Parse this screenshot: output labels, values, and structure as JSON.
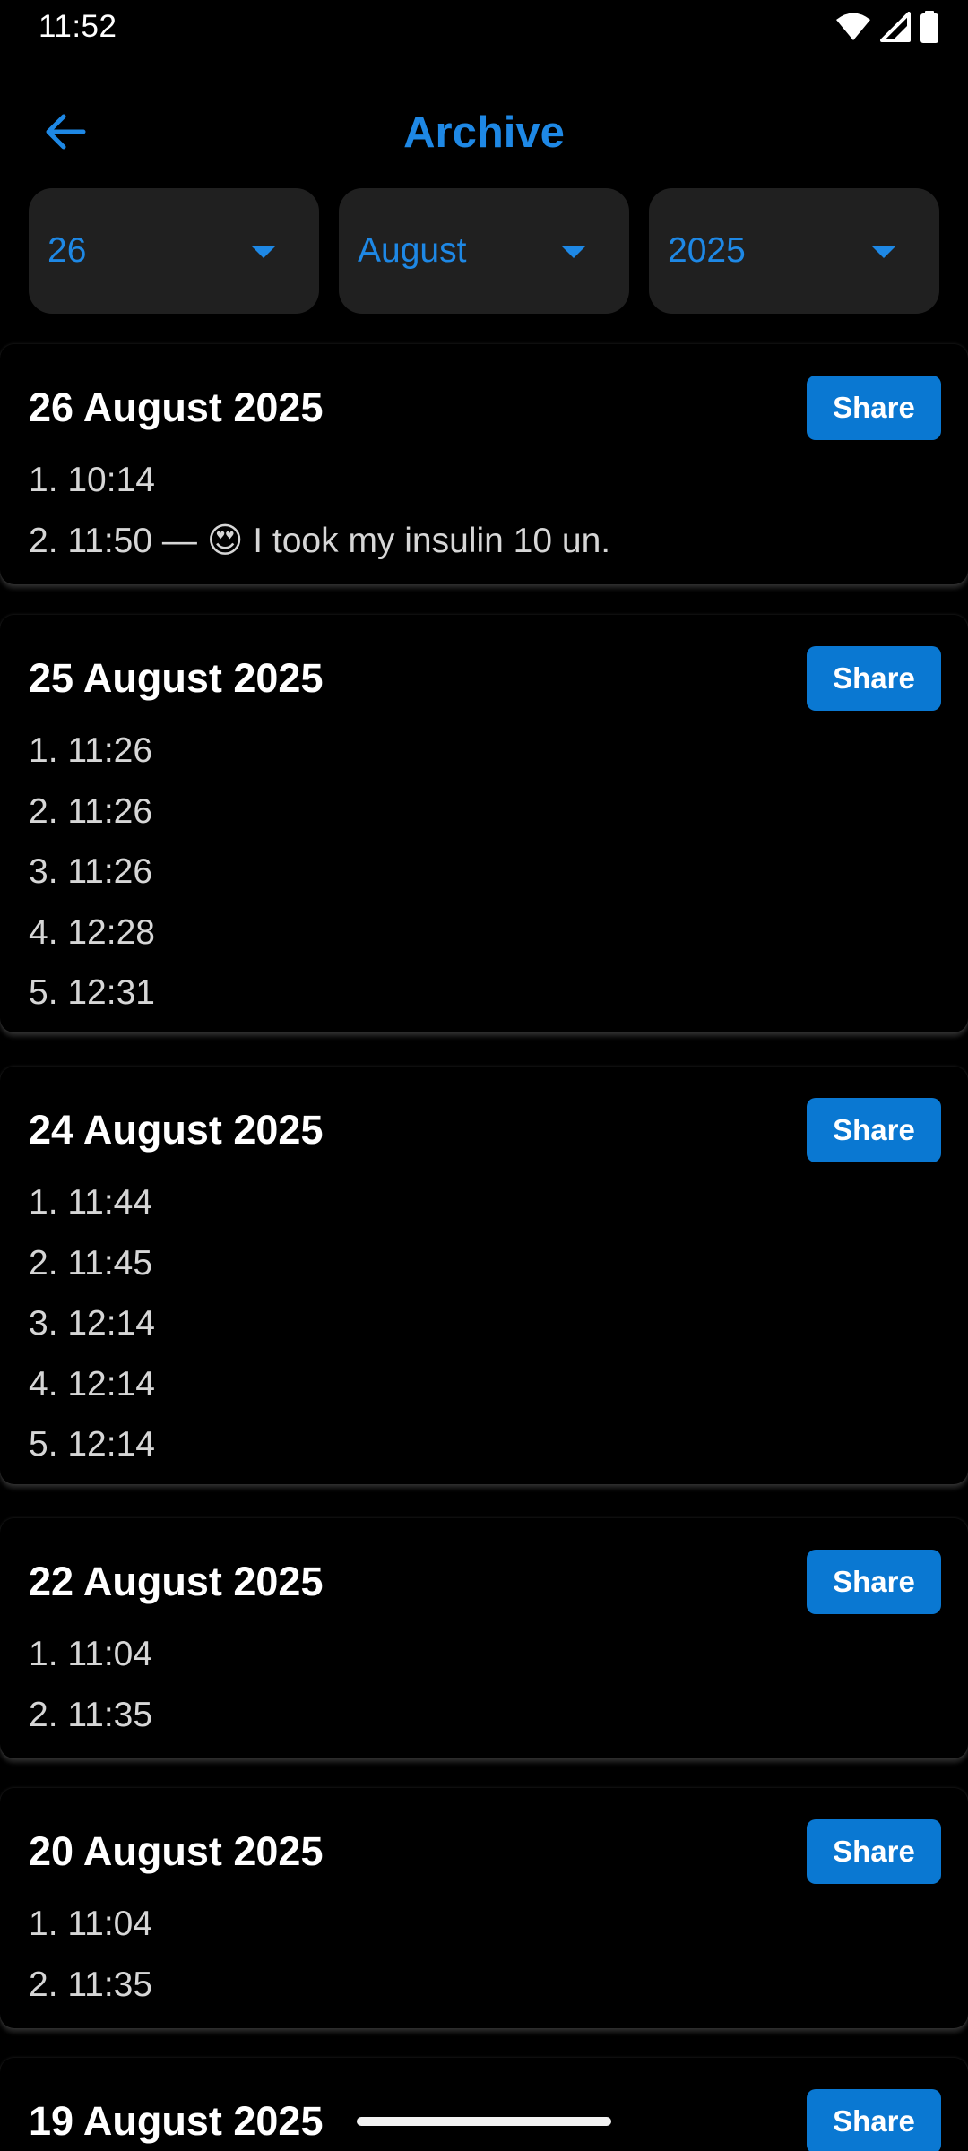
{
  "status_bar": {
    "time": "11:52",
    "icons": [
      "wifi-icon",
      "cell-signal-icon",
      "battery-icon"
    ]
  },
  "app_bar": {
    "back_icon": "arrow-left-icon",
    "title": "Archive"
  },
  "filters": {
    "day": "26",
    "month": "August",
    "year": "2025"
  },
  "share_label": "Share",
  "days": [
    {
      "title": "26 August 2025",
      "entries": [
        "1. 10:14",
        "2. 11:50 — 😍 I took my insulin 10 un."
      ]
    },
    {
      "title": "25 August 2025",
      "entries": [
        "1. 11:26",
        "2. 11:26",
        "3. 11:26",
        "4. 12:28",
        "5. 12:31"
      ]
    },
    {
      "title": "24 August 2025",
      "entries": [
        "1. 11:44",
        "2. 11:45",
        "3. 12:14",
        "4. 12:14",
        "5. 12:14"
      ]
    },
    {
      "title": "22 August 2025",
      "entries": [
        "1. 11:04",
        "2. 11:35"
      ]
    },
    {
      "title": "20 August 2025",
      "entries": [
        "1. 11:04",
        "2. 11:35"
      ]
    },
    {
      "title": "19 August 2025",
      "entries": []
    }
  ],
  "colors": {
    "accent": "#1e88e5",
    "share_button": "#0a78d2",
    "background": "#000000",
    "filter_background": "#202020"
  }
}
